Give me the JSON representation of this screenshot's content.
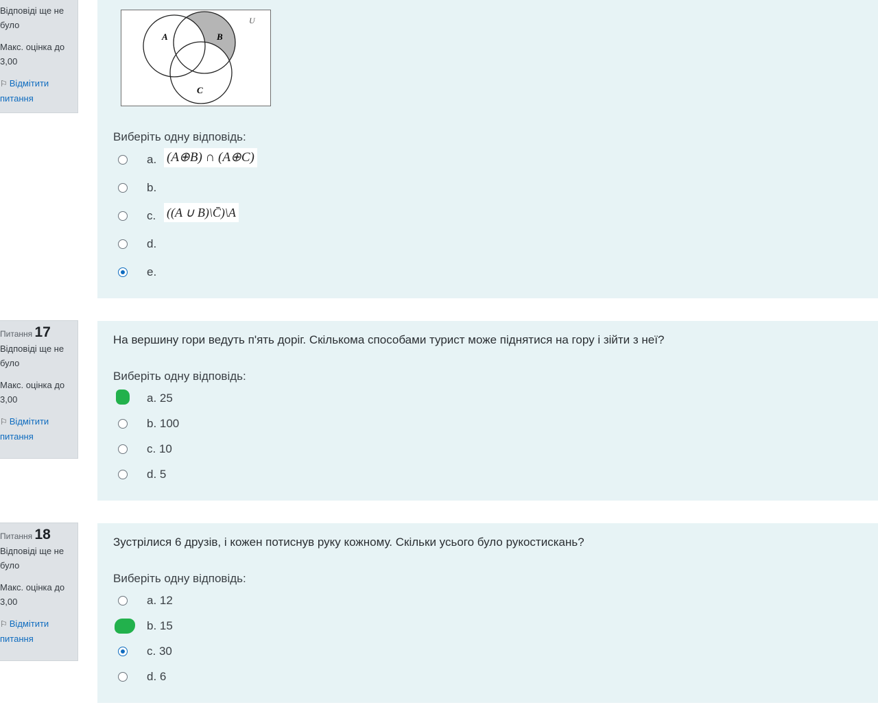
{
  "q16": {
    "info": {
      "status": "Відповіді ще не було",
      "max_grade": "Макс. оцінка до 3,00",
      "flag": "Відмітити питання"
    },
    "venn": {
      "label_a": "A",
      "label_b": "B",
      "label_c": "C",
      "label_u": "U",
      "shaded": "B"
    },
    "prompt": "Виберіть одну відповідь:",
    "options": [
      {
        "letter": "a.",
        "formula": "(A⊕B) ∩ (A⊕C)",
        "checked": false
      },
      {
        "letter": "b.",
        "checked": false
      },
      {
        "letter": "c.",
        "formula": "((A ∪ B)\\C̄)\\A",
        "checked": false
      },
      {
        "letter": "d.",
        "checked": false
      },
      {
        "letter": "e.",
        "checked": true
      }
    ]
  },
  "q17": {
    "info": {
      "question_word": "Питання",
      "number": "17",
      "status": "Відповіді ще не було",
      "max_grade": "Макс. оцінка до 3,00",
      "flag": "Відмітити питання"
    },
    "text": "На вершину гори ведуть п'ять доріг. Скількома способами турист може піднятися на гору і зійти з неї?",
    "prompt": "Виберіть одну відповідь:",
    "options": [
      {
        "label": "a. 25",
        "checked": false,
        "green_mark": true
      },
      {
        "label": "b. 100",
        "checked": false
      },
      {
        "label": "c. 10",
        "checked": false
      },
      {
        "label": "d. 5",
        "checked": false
      }
    ]
  },
  "q18": {
    "info": {
      "question_word": "Питання",
      "number": "18",
      "status": "Відповіді ще не було",
      "max_grade": "Макс. оцінка до 3,00",
      "flag": "Відмітити питання"
    },
    "text": "Зустрілися 6 друзів, і кожен потиснув руку кожному. Скільки усього було рукостискань?",
    "prompt": "Виберіть одну відповідь:",
    "options": [
      {
        "label": "a. 12",
        "checked": false
      },
      {
        "label": "b. 15",
        "checked": false,
        "green_mark": true
      },
      {
        "label": "c. 30",
        "checked": true
      },
      {
        "label": "d. 6",
        "checked": false
      }
    ]
  },
  "colors": {
    "accent": "#0f6cbf",
    "panel": "#e7f3f5",
    "info_bg": "#dee2e6",
    "marker": "#22b14c"
  }
}
